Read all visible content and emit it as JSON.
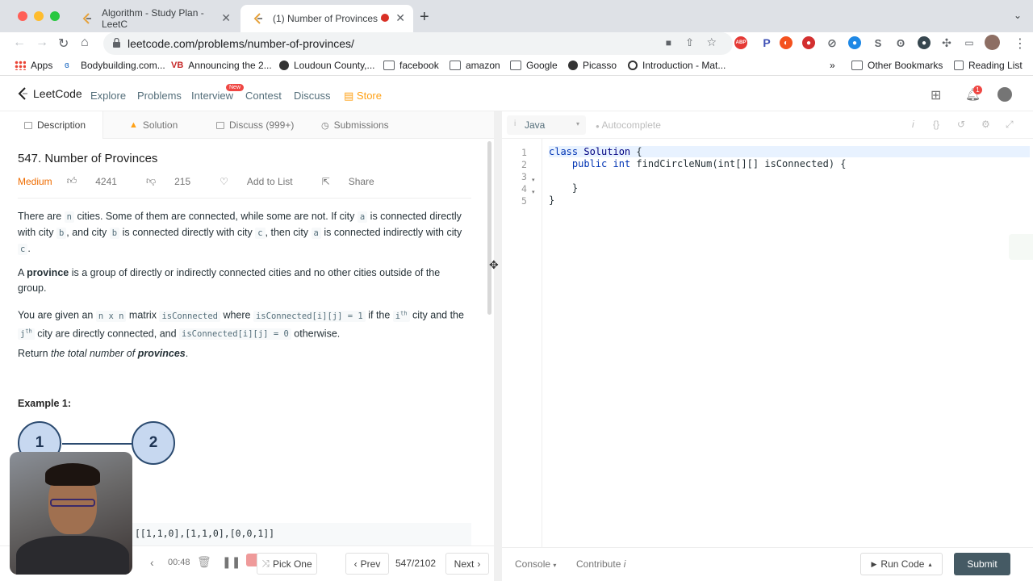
{
  "browser": {
    "tabs": [
      {
        "title": "Algorithm - Study Plan - LeetC"
      },
      {
        "title": "(1) Number of Provinces - "
      }
    ],
    "url": "leetcode.com/problems/number-of-provinces/",
    "bookmarks": [
      {
        "label": "Apps"
      },
      {
        "label": "Bodybuilding.com..."
      },
      {
        "label": "Announcing the 2..."
      },
      {
        "label": "Loudoun County,..."
      },
      {
        "label": "facebook"
      },
      {
        "label": "amazon"
      },
      {
        "label": "Google"
      },
      {
        "label": "Picasso"
      },
      {
        "label": "Introduction - Mat..."
      }
    ],
    "overflow": "»",
    "other_bookmarks": "Other Bookmarks",
    "reading_list": "Reading List"
  },
  "lc_nav": {
    "brand": "LeetCode",
    "items": [
      "Explore",
      "Problems",
      "Interview",
      "Contest",
      "Discuss"
    ],
    "store": "Store",
    "new_badge": "New",
    "notif_count": "1"
  },
  "left_tabs": [
    "Description",
    "Solution",
    "Discuss (999+)",
    "Submissions"
  ],
  "problem": {
    "title": "547. Number of Provinces",
    "difficulty": "Medium",
    "likes": "4241",
    "dislikes": "215",
    "add_to_list": "Add to List",
    "share": "Share",
    "p1": {
      "a": "There are ",
      "n": "n",
      "b": " cities. Some of them are connected, while some are not. If city ",
      "ca": "a",
      "c": " is connected directly with city ",
      "cb": "b",
      "d": ", and city ",
      "cb2": "b",
      "e": " is connected directly with city ",
      "cc": "c",
      "f": ", then city ",
      "ca2": "a",
      "g": " is connected indirectly with city ",
      "cc2": "c",
      "h": "."
    },
    "p2": {
      "a": "A ",
      "b": "province",
      "c": " is a group of directly or indirectly connected cities and no other cities outside of the group."
    },
    "p3": {
      "a": "You are given an ",
      "m": "n x n",
      "b": " matrix ",
      "ic": "isConnected",
      "c": " where ",
      "eq1": "isConnected[i][j] = 1",
      "d": " if the ",
      "i": "i",
      "ith": "th",
      "e": " city and the ",
      "j": "j",
      "jth": "th",
      "f": " city are directly connected, and ",
      "eq0": "isConnected[i][j] = 0",
      "g": " otherwise."
    },
    "p4": {
      "a": "Return ",
      "b": "the total number of ",
      "c": "provinces",
      "d": "."
    },
    "example_title": "Example 1:",
    "node1": "1",
    "node2": "2",
    "example_input": "[[1,1,0],[1,1,0],[0,0,1]]"
  },
  "bottom": {
    "timer": "00:48",
    "pick_one": "Pick One",
    "prev": "Prev",
    "pager": "547/2102",
    "next": "Next"
  },
  "editor": {
    "language": "Java",
    "autocomplete": "Autocomplete",
    "line_numbers": [
      "1",
      "2",
      "3",
      "4",
      "5"
    ],
    "code": {
      "l1_kw": "class",
      "l1_cls": "Solution",
      "l1_rest": " {",
      "l2_kw": "public",
      "l2_type": "int",
      "l2_rest": " findCircleNum(int[][] isConnected) {",
      "l4": "    }",
      "l5": "}"
    },
    "console": "Console",
    "contribute": "Contribute",
    "run_code": "Run Code",
    "submit": "Submit"
  },
  "colors": {
    "accent": "#ffa116",
    "submit_bg": "#455a64",
    "difficulty_medium": "#ef6c00"
  }
}
